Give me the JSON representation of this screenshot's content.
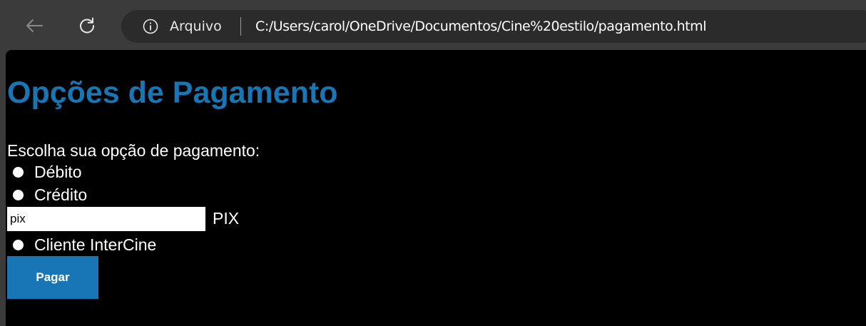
{
  "browser": {
    "back_icon": "back-arrow-icon",
    "reload_icon": "reload-icon",
    "info_icon": "info-icon",
    "site_label": "Arquivo",
    "url": "C:/Users/carol/OneDrive/Documentos/Cine%20estilo/pagamento.html"
  },
  "page": {
    "title": "Opções de Pagamento",
    "prompt": "Escolha sua opção de pagamento:",
    "options": [
      {
        "label": "Débito",
        "checked": false
      },
      {
        "label": "Crédito",
        "checked": false
      },
      {
        "label": "Cliente InterCine",
        "checked": false
      }
    ],
    "pix_input": {
      "value": "pix"
    },
    "pix_label": "PIX",
    "pay_button": "Pagar"
  },
  "colors": {
    "accent": "#1976b4",
    "page_background": "#000000",
    "chrome_background": "#3b3b3b",
    "address_bar": "#2b2b2b"
  }
}
